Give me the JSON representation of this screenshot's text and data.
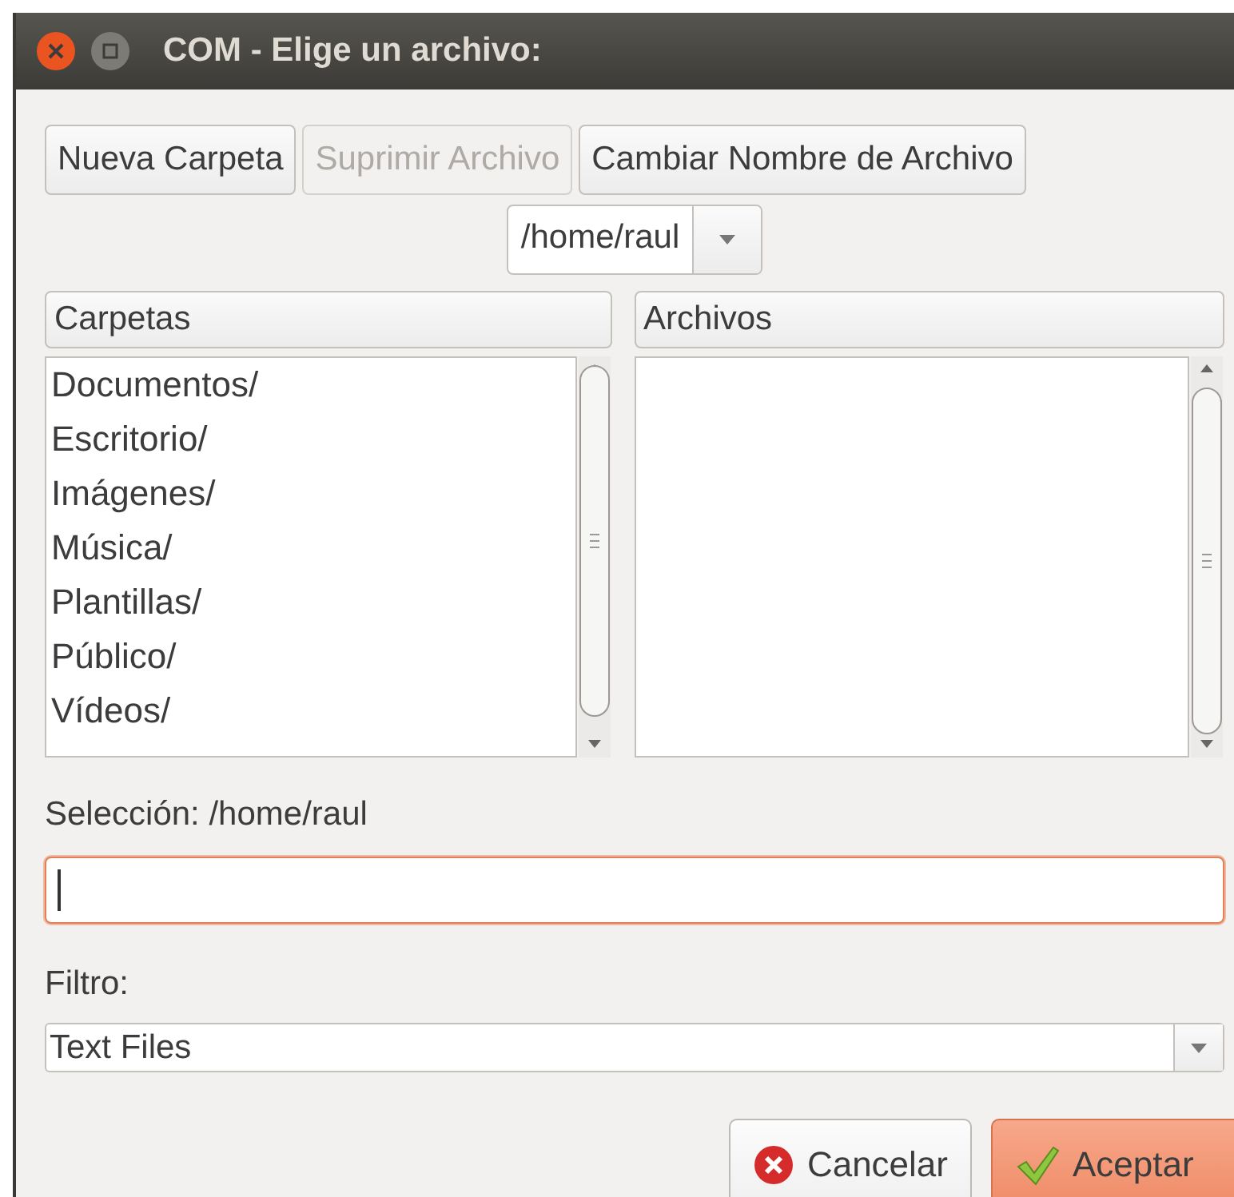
{
  "window": {
    "title": "COM - Elige un archivo:"
  },
  "toolbar_buttons": [
    {
      "label": "Nueva Carpeta",
      "disabled": false
    },
    {
      "label": "Suprimir Archivo",
      "disabled": true
    },
    {
      "label": "Cambiar Nombre de Archivo",
      "disabled": false
    }
  ],
  "path_combo": {
    "value": "/home/raul"
  },
  "folders": {
    "header": "Carpetas",
    "items": [
      "Documentos/",
      "Escritorio/",
      "Imágenes/",
      "Música/",
      "Plantillas/",
      "Público/",
      "Vídeos/"
    ]
  },
  "files": {
    "header": "Archivos"
  },
  "selection": {
    "label": "Selección: /home/raul",
    "focused": true
  },
  "filter": {
    "label": "Filtro:",
    "value": "Text Files"
  },
  "dialog_buttons": [
    {
      "kind": "cancel",
      "label": "Cancelar",
      "default": false
    },
    {
      "kind": "accept",
      "label": "Aceptar",
      "default": true
    }
  ]
}
